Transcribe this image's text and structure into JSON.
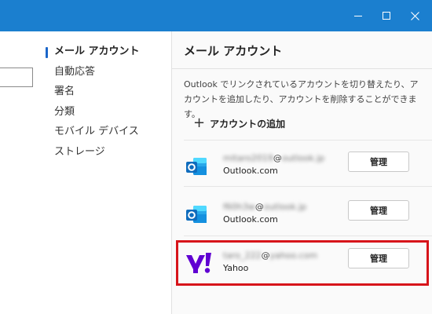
{
  "window": {
    "controls": [
      "minimize",
      "maximize",
      "close"
    ],
    "titlebar_color": "#1b7fcf"
  },
  "nav": {
    "items": [
      {
        "label": "メール アカウント",
        "active": true
      },
      {
        "label": "自動応答"
      },
      {
        "label": "署名"
      },
      {
        "label": "分類"
      },
      {
        "label": "モバイル デバイス"
      },
      {
        "label": "ストレージ"
      }
    ]
  },
  "main": {
    "title": "メール アカウント",
    "description": "Outlook でリンクされているアカウントを切り替えたり、アカウントを追加したり、アカウントを削除することができます。",
    "add_account_label": "アカウントの追加",
    "accounts": [
      {
        "email_user": "mitaro2019",
        "email_at": "@",
        "email_domain": "outlook.jp",
        "type": "Outlook.com",
        "manage_label": "管理",
        "icon": "outlook-icon"
      },
      {
        "email_user": "f60h3w",
        "email_at": "@",
        "email_domain": "outlook.jp",
        "type": "Outlook.com",
        "manage_label": "管理",
        "icon": "outlook-icon"
      },
      {
        "email_user": "taro_222",
        "email_at": "@",
        "email_domain": "yahoo.com",
        "type": "Yahoo",
        "manage_label": "管理",
        "icon": "yahoo-icon"
      }
    ]
  },
  "colors": {
    "accent": "#1b66c9",
    "highlight_border": "#d7141a",
    "outlook_blue": "#0f6cbd",
    "yahoo_purple": "#6001d2"
  }
}
